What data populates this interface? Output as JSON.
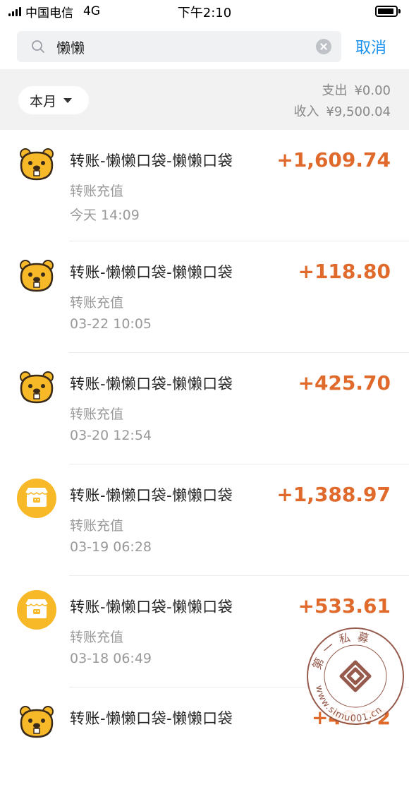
{
  "status_bar": {
    "carrier": "中国电信",
    "network": "4G",
    "time": "下午2:10"
  },
  "search": {
    "query": "懒懒",
    "cancel_label": "取消"
  },
  "summary": {
    "period_label": "本月",
    "expense_label": "支出",
    "expense_value": "¥0.00",
    "income_label": "收入",
    "income_value": "¥9,500.04"
  },
  "transactions": [
    {
      "avatar": "beaver-icon",
      "title": "转账-懒懒口袋-懒懒口袋",
      "subtitle": "转账充值",
      "time": "今天  14:09",
      "amount": "+1,609.74"
    },
    {
      "avatar": "beaver-icon",
      "title": "转账-懒懒口袋-懒懒口袋",
      "subtitle": "转账充值",
      "time": "03-22  10:05",
      "amount": "+118.80"
    },
    {
      "avatar": "beaver-icon",
      "title": "转账-懒懒口袋-懒懒口袋",
      "subtitle": "转账充值",
      "time": "03-20  12:54",
      "amount": "+425.70"
    },
    {
      "avatar": "shop-icon",
      "title": "转账-懒懒口袋-懒懒口袋",
      "subtitle": "转账充值",
      "time": "03-19  06:28",
      "amount": "+1,388.97"
    },
    {
      "avatar": "shop-icon",
      "title": "转账-懒懒口袋-懒懒口袋",
      "subtitle": "转账充值",
      "time": "03-18  06:49",
      "amount": "+533.61"
    },
    {
      "avatar": "beaver-icon",
      "title": "转账-懒懒口袋-懒懒口袋",
      "subtitle": "",
      "time": "",
      "amount": "+40.72"
    }
  ],
  "watermark": {
    "text_top": "第一私募",
    "text_bottom": "www.simu001.cn"
  },
  "colors": {
    "accent": "#1a91eb",
    "income": "#e06a2b",
    "avatar_yellow": "#f7b928"
  }
}
